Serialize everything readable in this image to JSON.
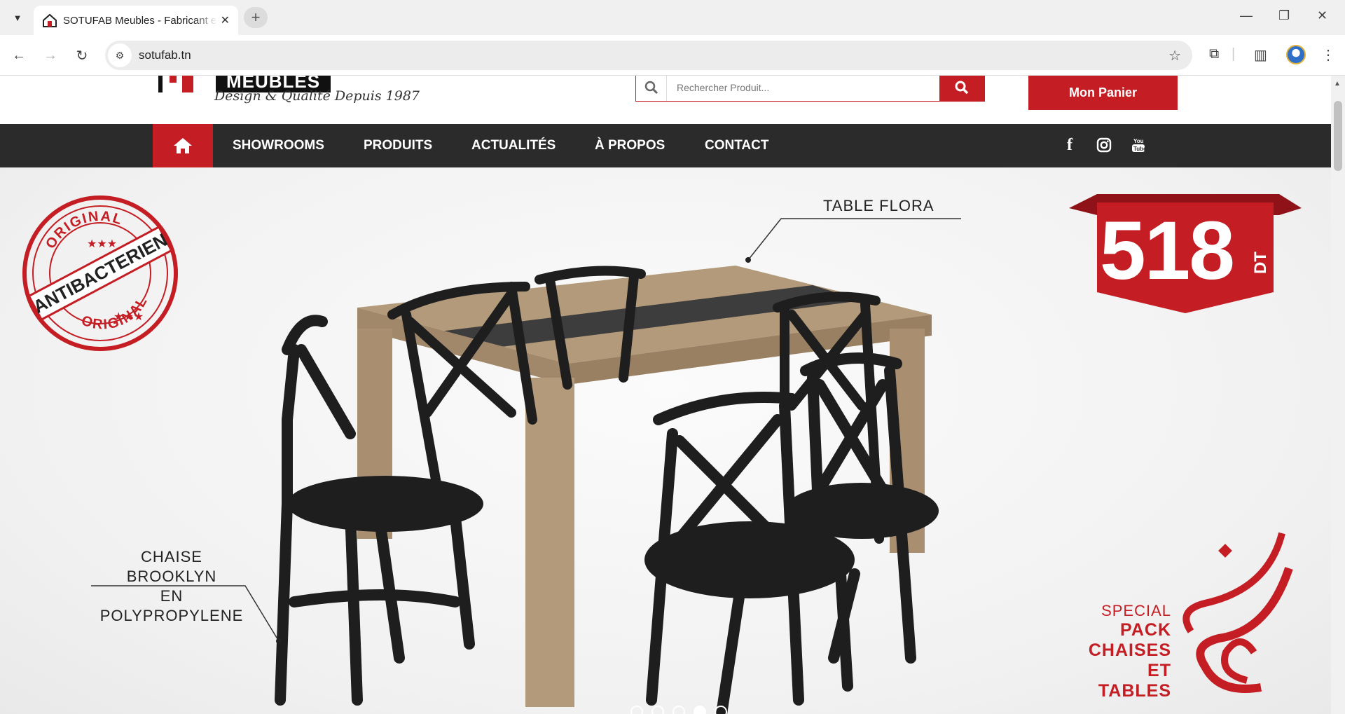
{
  "browser": {
    "tab_title": "SOTUFAB Meubles - Fabricant et",
    "url": "sotufab.tn",
    "new_tab": "+",
    "tab_close": "✕"
  },
  "header": {
    "logo_text": "MEUBLES",
    "tagline": "Design & Qualité Depuis 1987",
    "search_placeholder": "Rechercher Produit...",
    "cart_label": "Mon Panier"
  },
  "nav": {
    "items": [
      "SHOWROOMS",
      "PRODUITS",
      "ACTUALITÉS",
      "À PROPOS",
      "CONTACT"
    ],
    "social": [
      "facebook-icon",
      "instagram-icon",
      "youtube-icon"
    ]
  },
  "hero": {
    "stamp_top": "ORIGINAL",
    "stamp_middle": "ANTIBACTERIEN",
    "stamp_bottom": "ORIGINAL",
    "table_label": "TABLE FLORA",
    "chair_label_1": "CHAISE BROOKLYN",
    "chair_label_2": "EN POLYPROPYLENE",
    "price": "518",
    "price_unit": "DT",
    "special_1": "SPECIAL",
    "special_2": "PACK",
    "special_3": "CHAISES",
    "special_4": "ET TABLES",
    "slides": 5,
    "active_slide": 4
  },
  "colors": {
    "brand_red": "#c41e24",
    "nav_dark": "#2b2b2b"
  }
}
